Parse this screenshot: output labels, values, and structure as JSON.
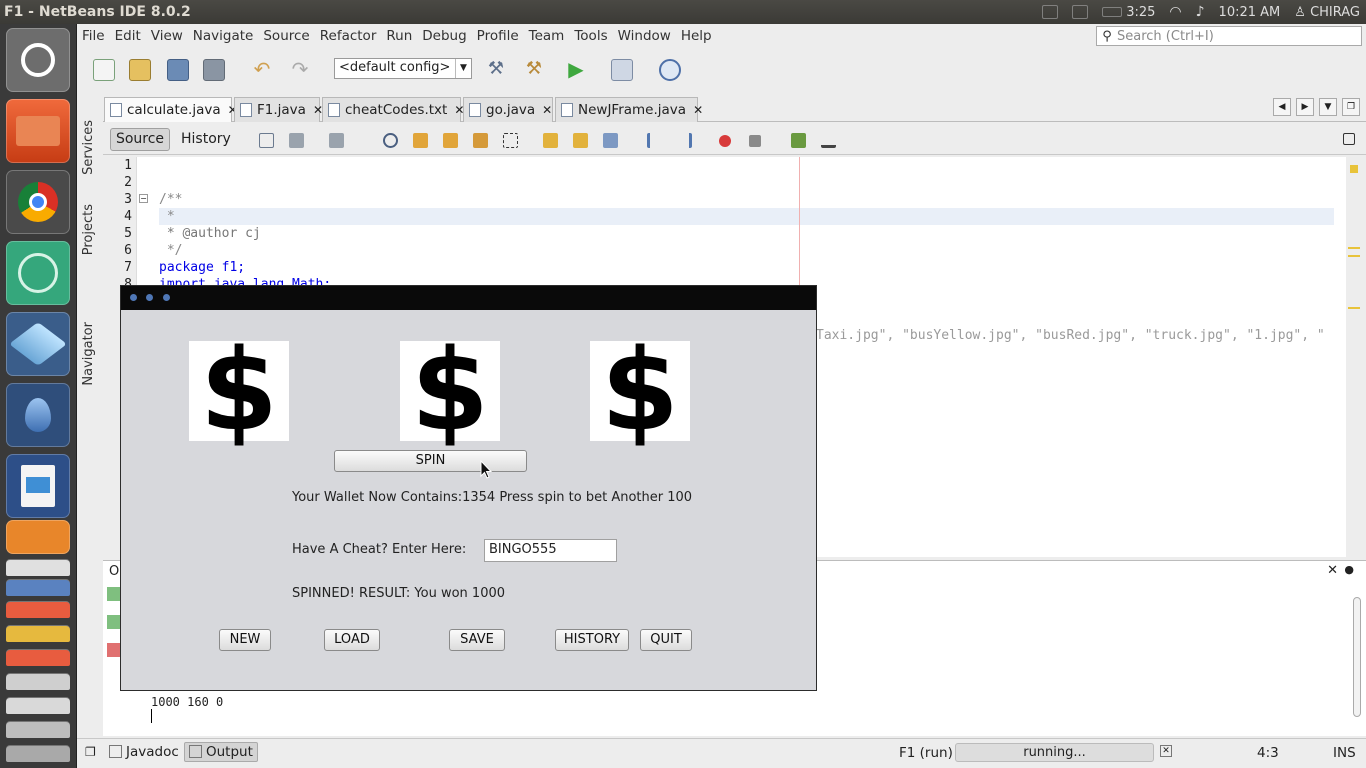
{
  "window_title": "F1 - NetBeans IDE 8.0.2",
  "system": {
    "battery_time": "3:25",
    "clock": "10:21 AM",
    "user": "CHIRAG"
  },
  "menu": [
    "File",
    "Edit",
    "View",
    "Navigate",
    "Source",
    "Refactor",
    "Run",
    "Debug",
    "Profile",
    "Team",
    "Tools",
    "Window",
    "Help"
  ],
  "search_placeholder": "Search (Ctrl+I)",
  "config_value": "<default config>",
  "side_panels": [
    "Services",
    "Projects",
    "Navigator"
  ],
  "tabs": [
    "calculate.java",
    "F1.java",
    "cheatCodes.txt",
    "go.java",
    "NewJFrame.java"
  ],
  "editor_tabs": {
    "source": "Source",
    "history": "History"
  },
  "code": {
    "line_numbers": [
      "1",
      "2",
      "3",
      "4",
      "5",
      "6",
      "7",
      "8"
    ],
    "lines": [
      "/**",
      " *",
      " * @author cj",
      " */",
      "package f1;",
      "import java.lang.Math;"
    ],
    "string_fragment": "Taxi.jpg\", \"busYellow.jpg\", \"busRed.jpg\", \"truck.jpg\", \"1.jpg\", \""
  },
  "output": {
    "label": "Ou",
    "lines": [
      "1000 160 0"
    ]
  },
  "bottom": {
    "javadoc": "Javadoc",
    "output": "Output",
    "run_label": "F1 (run)",
    "progress": "running...",
    "position": "4:3",
    "mode": "INS"
  },
  "dialog": {
    "reel_symbols": [
      "$",
      "$",
      "$"
    ],
    "spin_label": "SPIN",
    "wallet_text": "Your Wallet Now Contains:1354 Press spin to bet Another 100",
    "cheat_label": "Have A Cheat? Enter Here:",
    "cheat_value": "BINGO555",
    "result_text": "SPINNED! RESULT: You won 1000",
    "buttons": [
      "NEW",
      "LOAD",
      "SAVE",
      "HISTORY",
      "QUIT"
    ]
  }
}
